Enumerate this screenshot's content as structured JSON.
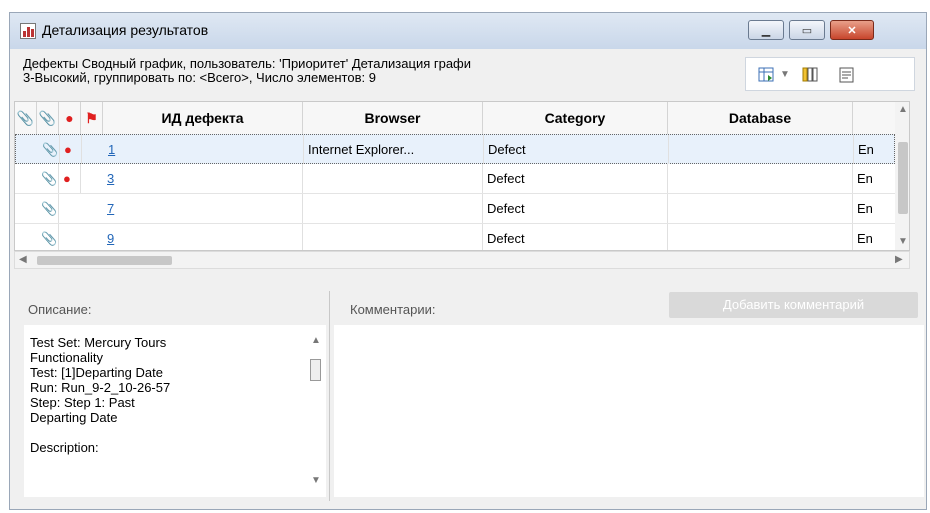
{
  "window": {
    "title": "Детализация результатов"
  },
  "summary": {
    "line1": "Дефекты Сводный график, пользователь: 'Приоритет' Детализация графи",
    "line2": "3-Высокий, группировать по: <Всего>, Число элементов: 9"
  },
  "toolbar": {
    "icons": [
      "select-columns-icon",
      "column-chooser-icon",
      "filter-icon"
    ]
  },
  "grid": {
    "columns": [
      "ИД дефекта",
      "Browser",
      "Category",
      "Database"
    ],
    "rows": [
      {
        "id": "1",
        "browser": "Internet Explorer...",
        "category": "Defect",
        "database": "",
        "extra": "En",
        "attach": true,
        "alert": true
      },
      {
        "id": "3",
        "browser": "",
        "category": "Defect",
        "database": "",
        "extra": "En",
        "attach": true,
        "alert": true
      },
      {
        "id": "7",
        "browser": "",
        "category": "Defect",
        "database": "",
        "extra": "En",
        "attach": true,
        "alert": false
      },
      {
        "id": "9",
        "browser": "",
        "category": "Defect",
        "database": "",
        "extra": "En",
        "attach": true,
        "alert": false
      }
    ]
  },
  "description": {
    "label": "Описание:",
    "lines": [
      "Test Set: Mercury Tours",
      "Functionality",
      "Test: [1]Departing Date",
      "Run: Run_9-2_10-26-57",
      "Step: Step 1: Past",
      "Departing Date",
      "",
      "Description:"
    ]
  },
  "comments": {
    "label": "Комментарии:",
    "add_button": "Добавить комментарий"
  },
  "colors": {
    "link": "#2266b8",
    "alert": "#e02020",
    "close": "#c8452c"
  }
}
